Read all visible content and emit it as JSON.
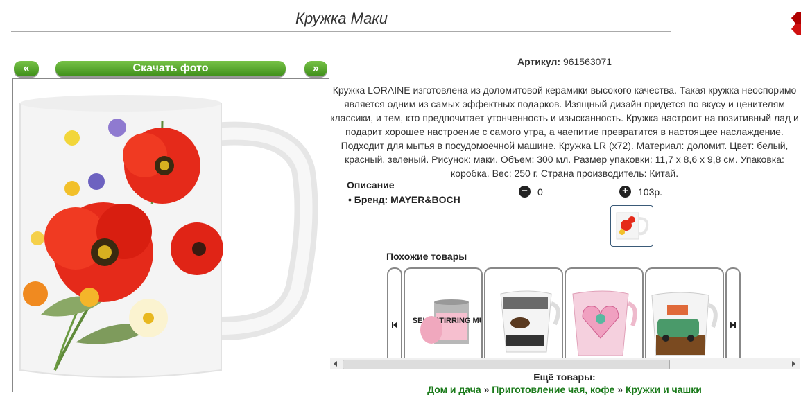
{
  "page": {
    "title": "Кружка Маки"
  },
  "toolbar": {
    "prev_label": "«",
    "download_label": "Скачать фото",
    "next_label": "»"
  },
  "product": {
    "sku_label": "Артикул:",
    "sku_value": "961563071",
    "description": "Кружка LORAINE изготовлена из доломитовой керамики высокого качества. Такая кружка неоспоримо является одним из самых эффектных подарков. Изящный дизайн придется по вкусу и ценителям классики, и тем, кто предпочитает утонченность и изысканность. Кружка настроит на позитивный лад и подарит хорошее настроение с самого утра, а чаепитие превратится в настоящее наслаждение. Подходит для мытья в посудомоечной машине. Кружка LR (x72). Материал: доломит. Цвет: белый, красный, зеленый. Рисунок: маки. Объем: 300 мл. Размер упаковки: 11,7 x 8,6 x 9,8 см. Упаковка: коробка. Вес: 250 г. Страна производитель: Китай.",
    "spec_title": "Описание",
    "brand": "Бренд: MAYER&BOCH",
    "quantity": "0",
    "price": "103р."
  },
  "similar": {
    "title": "Похожие товары",
    "items": [
      {
        "label": "SELF STIRRING MUG"
      },
      {
        "label": "Кружка кофе"
      },
      {
        "label": "Кружка сердце"
      },
      {
        "label": "Кружка машина"
      }
    ]
  },
  "more": {
    "title": "Ещё товары:",
    "crumbs": [
      "Дом и дача",
      "Приготовление чая, кофе",
      "Кружки и чашки"
    ],
    "separator": "»"
  },
  "colors": {
    "accent_green": "#4ea524",
    "close_red": "#d01010",
    "link_green": "#1a7a1a"
  }
}
